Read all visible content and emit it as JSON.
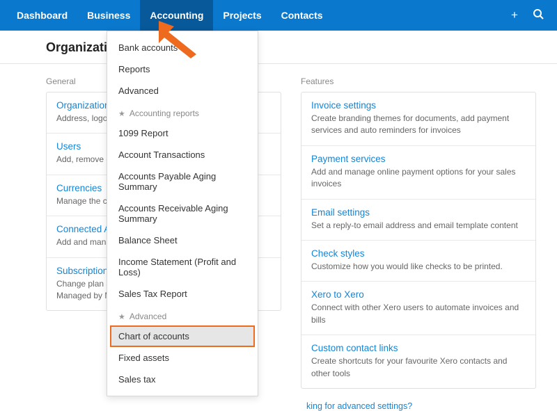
{
  "nav": {
    "items": [
      "Dashboard",
      "Business",
      "Accounting",
      "Projects",
      "Contacts"
    ],
    "active_index": 2
  },
  "page_title": "Organization s",
  "left": {
    "header": "General",
    "rows": [
      {
        "title": "Organization d",
        "desc": "Address, logo a"
      },
      {
        "title": "Users",
        "desc": "Add, remove or"
      },
      {
        "title": "Currencies",
        "desc": "Manage the cu"
      },
      {
        "title": "Connected Ap",
        "desc": "Add and mana"
      },
      {
        "title": "Subscription a",
        "desc": "Change plan an\nManaged by Ma"
      }
    ]
  },
  "right": {
    "header": "Features",
    "rows": [
      {
        "title": "Invoice settings",
        "desc": "Create branding themes for documents, add payment services and auto reminders for invoices"
      },
      {
        "title": "Payment services",
        "desc": "Add and manage online payment options for your sales invoices"
      },
      {
        "title": "Email settings",
        "desc": "Set a reply-to email address and email template content"
      },
      {
        "title": "Check styles",
        "desc": "Customize how you would like checks to be printed."
      },
      {
        "title": "Xero to Xero",
        "desc": "Connect with other Xero users to automate invoices and bills"
      },
      {
        "title": "Custom contact links",
        "desc": "Create shortcuts for your favourite Xero contacts and other tools"
      }
    ]
  },
  "advanced_link": "king for advanced settings?",
  "dropdown": {
    "top": [
      "Bank accounts",
      "Reports",
      "Advanced"
    ],
    "section1_header": "Accounting reports",
    "section1": [
      "1099 Report",
      "Account Transactions",
      "Accounts Payable Aging Summary",
      "Accounts Receivable Aging Summary",
      "Balance Sheet",
      "Income Statement (Profit and Loss)",
      "Sales Tax Report"
    ],
    "section2_header": "Advanced",
    "section2": [
      "Chart of accounts",
      "Fixed assets",
      "Sales tax"
    ],
    "highlighted": "Chart of accounts"
  }
}
